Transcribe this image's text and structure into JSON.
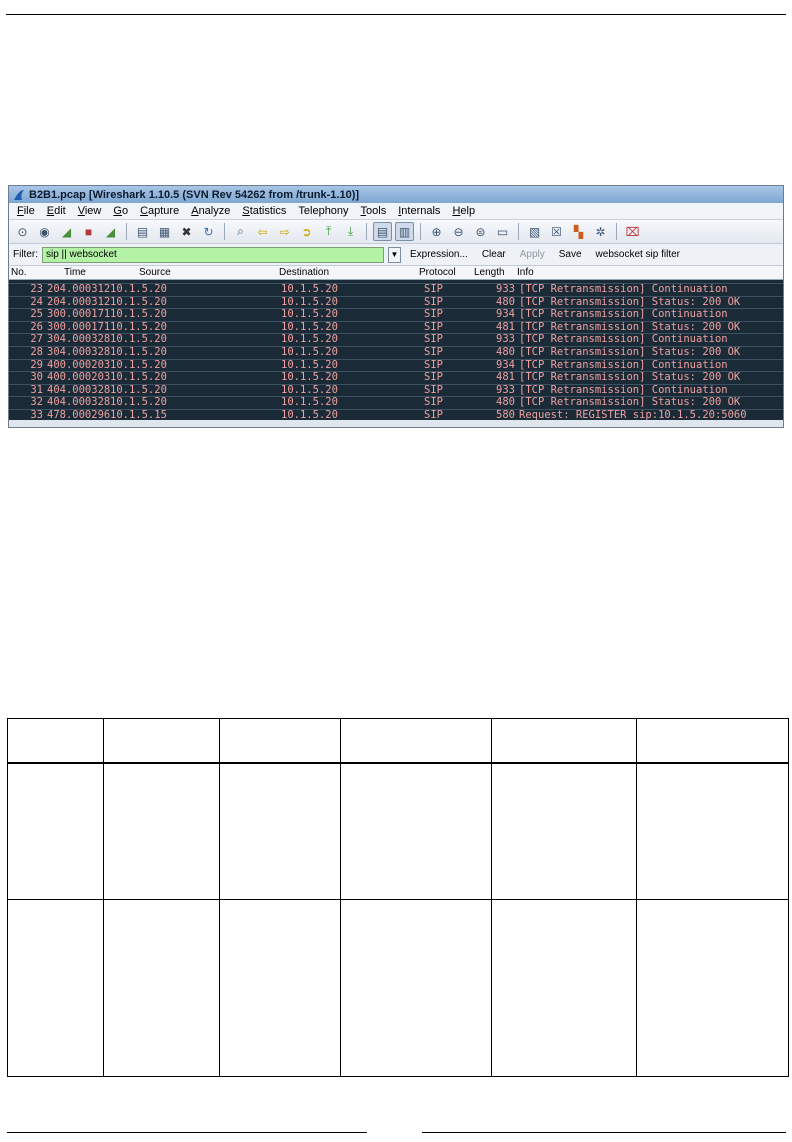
{
  "window": {
    "title": "B2B1.pcap  [Wireshark 1.10.5  (SVN Rev 54262 from /trunk-1.10)]"
  },
  "menu": [
    {
      "label": "File",
      "u": "F",
      "rest": "ile"
    },
    {
      "label": "Edit",
      "u": "E",
      "rest": "dit"
    },
    {
      "label": "View",
      "u": "V",
      "rest": "iew"
    },
    {
      "label": "Go",
      "u": "G",
      "rest": "o"
    },
    {
      "label": "Capture",
      "u": "C",
      "rest": "apture"
    },
    {
      "label": "Analyze",
      "u": "A",
      "rest": "nalyze"
    },
    {
      "label": "Statistics",
      "u": "S",
      "rest": "tatistics"
    },
    {
      "label": "Telephony",
      "u": "",
      "rest": "Telephony"
    },
    {
      "label": "Tools",
      "u": "T",
      "rest": "ools"
    },
    {
      "label": "Internals",
      "u": "I",
      "rest": "nternals"
    },
    {
      "label": "Help",
      "u": "H",
      "rest": "elp"
    }
  ],
  "toolbar_icons": [
    "interface-list-icon",
    "capture-options-icon",
    "start-capture-icon",
    "stop-capture-icon",
    "restart-capture-icon",
    "sep",
    "open-file-icon",
    "save-file-icon",
    "close-file-icon",
    "reload-file-icon",
    "sep",
    "find-packet-icon",
    "go-back-icon",
    "go-forward-icon",
    "go-to-packet-icon",
    "go-first-icon",
    "go-last-icon",
    "sep",
    "colorize-icon",
    "auto-scroll-icon",
    "sep",
    "zoom-in-icon",
    "zoom-out-icon",
    "normal-size-icon",
    "resize-columns-icon",
    "sep",
    "capture-filters-icon",
    "display-filters-icon",
    "coloring-rules-icon",
    "preferences-icon",
    "sep",
    "help-icon"
  ],
  "filter": {
    "label": "Filter:",
    "value": "sip || websocket",
    "expression": "Expression...",
    "clear": "Clear",
    "apply": "Apply",
    "save": "Save",
    "saved_filter": "websocket sip filter"
  },
  "columns": {
    "no": "No.",
    "time": "Time",
    "source": "Source",
    "destination": "Destination",
    "protocol": "Protocol",
    "length": "Length",
    "info": "Info"
  },
  "packets": [
    {
      "no": "23",
      "time": "204.000312",
      "src": "10.1.5.20",
      "dst": "10.1.5.20",
      "proto": "SIP",
      "len": "933",
      "info": "[TCP Retransmission] Continuation"
    },
    {
      "no": "24",
      "time": "204.000312",
      "src": "10.1.5.20",
      "dst": "10.1.5.20",
      "proto": "SIP",
      "len": "480",
      "info": "[TCP Retransmission] Status: 200 OK"
    },
    {
      "no": "25",
      "time": "300.000171",
      "src": "10.1.5.20",
      "dst": "10.1.5.20",
      "proto": "SIP",
      "len": "934",
      "info": "[TCP Retransmission] Continuation"
    },
    {
      "no": "26",
      "time": "300.000171",
      "src": "10.1.5.20",
      "dst": "10.1.5.20",
      "proto": "SIP",
      "len": "481",
      "info": "[TCP Retransmission] Status: 200 OK"
    },
    {
      "no": "27",
      "time": "304.000328",
      "src": "10.1.5.20",
      "dst": "10.1.5.20",
      "proto": "SIP",
      "len": "933",
      "info": "[TCP Retransmission] Continuation"
    },
    {
      "no": "28",
      "time": "304.000328",
      "src": "10.1.5.20",
      "dst": "10.1.5.20",
      "proto": "SIP",
      "len": "480",
      "info": "[TCP Retransmission] Status: 200 OK"
    },
    {
      "no": "29",
      "time": "400.000203",
      "src": "10.1.5.20",
      "dst": "10.1.5.20",
      "proto": "SIP",
      "len": "934",
      "info": "[TCP Retransmission] Continuation"
    },
    {
      "no": "30",
      "time": "400.000203",
      "src": "10.1.5.20",
      "dst": "10.1.5.20",
      "proto": "SIP",
      "len": "481",
      "info": "[TCP Retransmission] Status: 200 OK"
    },
    {
      "no": "31",
      "time": "404.000328",
      "src": "10.1.5.20",
      "dst": "10.1.5.20",
      "proto": "SIP",
      "len": "933",
      "info": "[TCP Retransmission] Continuation"
    },
    {
      "no": "32",
      "time": "404.000328",
      "src": "10.1.5.20",
      "dst": "10.1.5.20",
      "proto": "SIP",
      "len": "480",
      "info": "[TCP Retransmission] Status: 200 OK"
    },
    {
      "no": "33",
      "time": "478.000296",
      "src": "10.1.5.15",
      "dst": "10.1.5.20",
      "proto": "SIP",
      "len": "580",
      "info": "Request: REGISTER sip:10.1.5.20:5060"
    }
  ],
  "colors": {
    "packet_bg": "#1a2b37",
    "packet_fg": "#f0a0a0",
    "filter_bg": "#b4f2a6"
  }
}
